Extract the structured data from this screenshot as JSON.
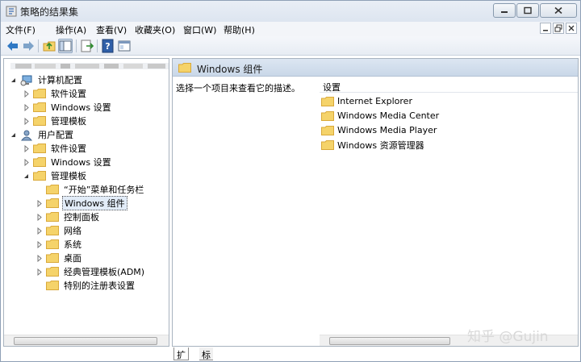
{
  "window": {
    "title": "策略的结果集"
  },
  "menu": [
    "文件(F)",
    "操作(A)",
    "查看(V)",
    "收藏夹(O)",
    "窗口(W)",
    "帮助(H)"
  ],
  "toolbar": {
    "icons": [
      "back-arrow-icon",
      "forward-arrow-icon",
      "up-folder-icon",
      "show-tree-icon",
      "export-icon",
      "help-icon",
      "properties-icon"
    ]
  },
  "tree": {
    "computer_config": "计算机配置",
    "software_settings_1": "软件设置",
    "windows_settings_1": "Windows 设置",
    "admin_templates_1": "管理模板",
    "user_config": "用户配置",
    "software_settings_2": "软件设置",
    "windows_settings_2": "Windows 设置",
    "admin_templates_2": "管理模板",
    "start_menu": "“开始”菜单和任务栏",
    "windows_components": "Windows 组件",
    "control_panel": "控制面板",
    "network": "网络",
    "system": "系统",
    "desktop": "桌面",
    "classic_adm": "经典管理模板(ADM)",
    "special_registry": "特别的注册表设置"
  },
  "detail": {
    "header_title": "Windows 组件",
    "description": "选择一个项目来查看它的描述。",
    "column_header": "设置",
    "items": [
      "Internet Explorer",
      "Windows Media Center",
      "Windows Media Player",
      "Windows 资源管理器"
    ]
  },
  "tabs": [
    "扩展",
    "标准"
  ],
  "watermark": "知乎 @Gujin",
  "colors": {
    "folder": "#f5d36a",
    "folder_dark": "#d9a93a",
    "selection": "#e2ecf8"
  }
}
